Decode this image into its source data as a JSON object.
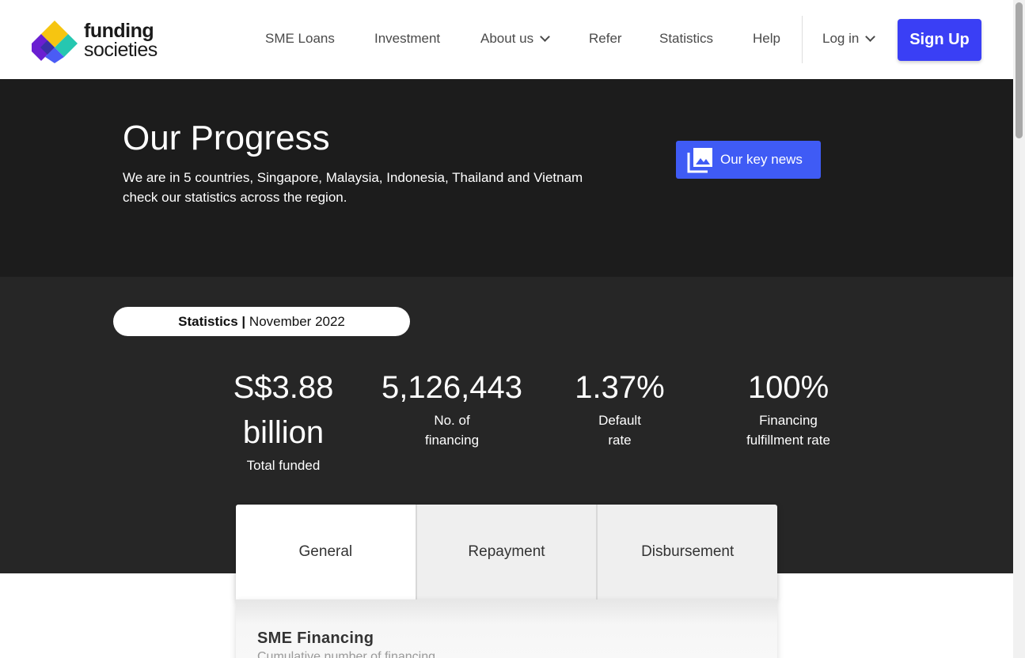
{
  "header": {
    "logo": {
      "line1": "funding",
      "line2": "societies"
    },
    "nav": [
      {
        "label": "SME Loans"
      },
      {
        "label": "Investment"
      },
      {
        "label": "About us"
      },
      {
        "label": "Refer"
      },
      {
        "label": "Statistics"
      },
      {
        "label": "Help"
      }
    ],
    "login_label": "Log in",
    "signup_label": "Sign Up"
  },
  "hero": {
    "title": "Our Progress",
    "subtitle_line1": "We are in 5 countries, Singapore, Malaysia, Indonesia, Thailand and Vietnam",
    "subtitle_line2": "check our statistics across the region.",
    "key_news_label": "Our key news"
  },
  "stats": {
    "pill_bold": "Statistics |",
    "pill_date": "November 2022",
    "items": [
      {
        "value_line1": "S$3.88",
        "value_line2": "billion",
        "label_line1": "Total funded",
        "label_line2": ""
      },
      {
        "value_line1": "5,126,443",
        "value_line2": "",
        "label_line1": "No. of",
        "label_line2": "financing"
      },
      {
        "value_line1": "1.37%",
        "value_line2": "",
        "label_line1": "Default",
        "label_line2": "rate"
      },
      {
        "value_line1": "100%",
        "value_line2": "",
        "label_line1": "Financing",
        "label_line2": "fulfillment rate"
      }
    ]
  },
  "tabs": [
    {
      "label": "General",
      "active": true
    },
    {
      "label": "Repayment",
      "active": false
    },
    {
      "label": "Disbursement",
      "active": false
    }
  ],
  "panel": {
    "title": "SME Financing",
    "subtitle": "Cumulative number of financing"
  },
  "colors": {
    "brand_blue": "#3a3ff5",
    "hero_bg": "#1c1c1c",
    "stats_bg": "#262626"
  }
}
